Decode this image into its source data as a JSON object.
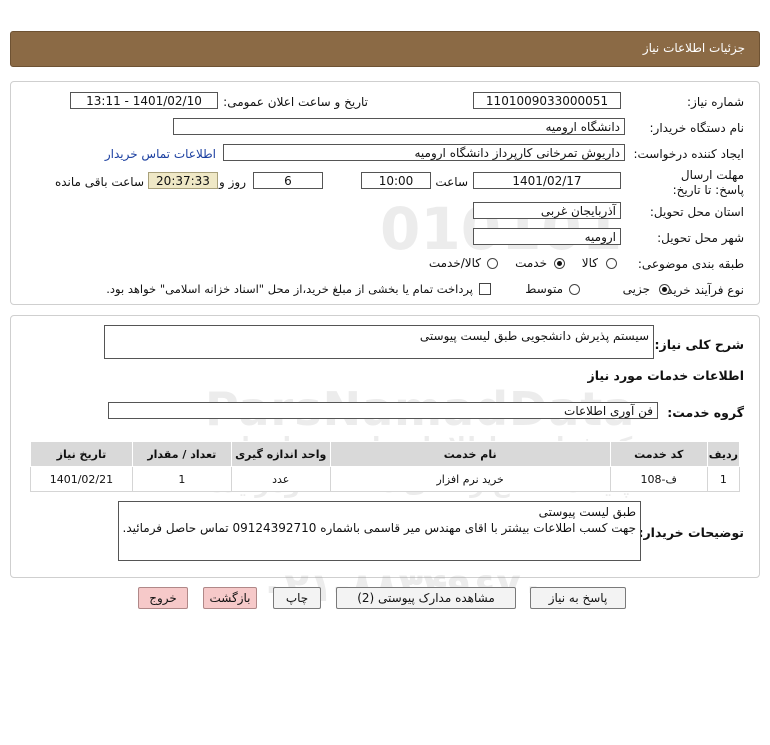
{
  "title": "جزئیات اطلاعات نیاز",
  "watermark": {
    "brand": "ParsNamadData",
    "digits": "010101",
    "line1": "مرکز فراوری اطلاعات پارس نماد داده",
    "line2": "پایگاه اطلاع رسانی مناقصه ومزایده",
    "phone": "۰۲۱-۸۸۳۴۹۶۷۰"
  },
  "fields": {
    "need_number_label": "شماره نیاز:",
    "need_number": "1101009033000051",
    "announce_label": "تاریخ و ساعت اعلان عمومی:",
    "announce_value": "1401/02/10 - 13:11",
    "buyer_org_label": "نام دستگاه خریدار:",
    "buyer_org": "دانشگاه ارومیه",
    "requester_label": "ایجاد کننده درخواست:",
    "requester": "داریوش تمرخانی کارپرداز دانشگاه ارومیه",
    "contact_link": "اطلاعات تماس خریدار",
    "deadline_label": "مهلت ارسال پاسخ: تا تاریخ:",
    "deadline_date": "1401/02/17",
    "time_label": "ساعت",
    "deadline_time": "10:00",
    "days_label": "روز و",
    "days": "6",
    "remaining": "20:37:33",
    "remaining_label": "ساعت باقی مانده",
    "province_label": "استان محل تحویل:",
    "province": "آذربایجان غربی",
    "city_label": "شهر محل تحویل:",
    "city": "ارومیه",
    "category_label": "طبقه بندی موضوعی:",
    "category_options": [
      "کالا",
      "خدمت",
      "کالا/خدمت"
    ],
    "category_selected": "خدمت",
    "purchase_type_label": "نوع فرآیند خرید :",
    "purchase_options": [
      "جزیی",
      "متوسط"
    ],
    "purchase_selected": "جزیی",
    "payment_note": "پرداخت تمام یا بخشی از مبلغ خرید،از محل \"اسناد خزانه اسلامی\" خواهد بود."
  },
  "details": {
    "summary_label": "شرح کلی نیاز:",
    "summary": "سیستم پذیرش دانشجویی طبق لیست پیوستی",
    "services_heading": "اطلاعات خدمات مورد نیاز",
    "service_group_label": "گروه خدمت:",
    "service_group": "فن آوری اطلاعات",
    "table_headers": [
      "ردیف",
      "کد خدمت",
      "نام خدمت",
      "واحد اندازه گیری",
      "تعداد / مقدار",
      "تاریخ نیاز"
    ],
    "table_rows": [
      [
        "1",
        "ف-108",
        "خرید نرم افزار",
        "عدد",
        "1",
        "1401/02/21"
      ]
    ],
    "buyer_notes_label": "توضیحات خریدار:",
    "buyer_notes_line1": "طبق لیست پیوستی",
    "buyer_notes_line2": "جهت کسب اطلاعات بیشتر با اقای مهندس میر قاسمی باشماره 09124392710 تماس حاصل فرمائید."
  },
  "buttons": {
    "reply": "پاسخ به نیاز",
    "attachments": "مشاهده مدارک پیوستی (2)",
    "print": "چاپ",
    "back": "بازگشت",
    "exit": "خروج"
  }
}
